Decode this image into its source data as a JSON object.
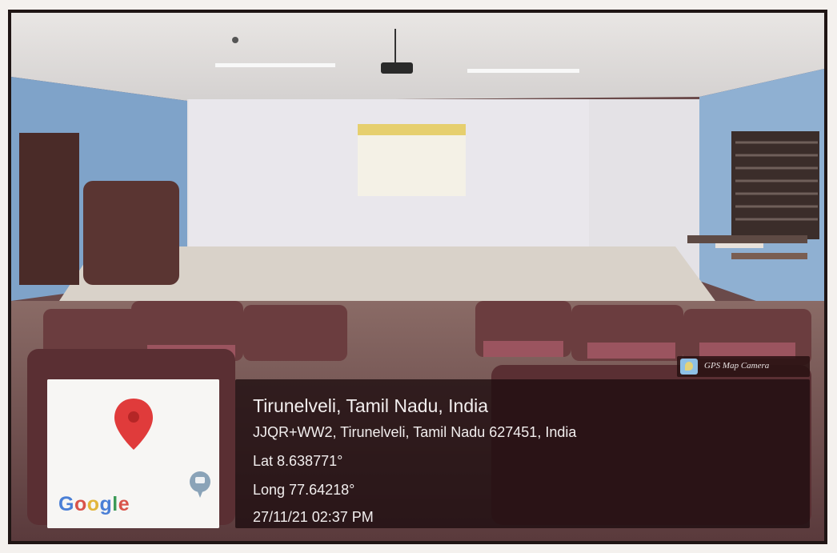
{
  "photo": {
    "description_icons": [
      "map-pin-icon",
      "camera-icon",
      "projector-icon"
    ]
  },
  "map_thumbnail": {
    "logo_letters": [
      {
        "ch": "G",
        "color": "#4a7fd6"
      },
      {
        "ch": "o",
        "color": "#d9534a"
      },
      {
        "ch": "o",
        "color": "#e2b53a"
      },
      {
        "ch": "g",
        "color": "#4a7fd6"
      },
      {
        "ch": "l",
        "color": "#3c9a57"
      },
      {
        "ch": "e",
        "color": "#d9534a"
      }
    ],
    "pin_color": "#e03b3b"
  },
  "badge": {
    "label": "GPS Map Camera"
  },
  "location": {
    "city": "Tirunelveli, Tamil Nadu, India",
    "address": "JJQR+WW2, Tirunelveli, Tamil Nadu 627451, India",
    "latitude": "Lat 8.638771°",
    "longitude": "Long 77.64218°",
    "datetime": "27/11/21 02:37 PM"
  }
}
